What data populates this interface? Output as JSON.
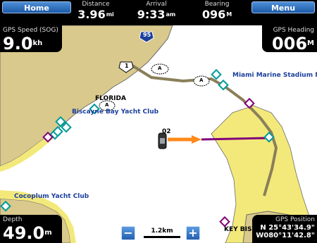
{
  "topbar": {
    "home_label": "Home",
    "menu_label": "Menu",
    "distance": {
      "label": "Distance",
      "value": "3.96",
      "unit": "mi"
    },
    "arrival": {
      "label": "Arrival",
      "value": "9:33",
      "unit": "am"
    },
    "bearing": {
      "label": "Bearing",
      "value": "096",
      "unit": "M"
    }
  },
  "gps_speed": {
    "label": "GPS Speed (SOG)",
    "value": "9.0",
    "unit": "kh"
  },
  "gps_heading": {
    "label": "GPS Heading",
    "value": "006",
    "unit": "M"
  },
  "depth": {
    "label": "Depth",
    "value": "49.0",
    "unit": "m"
  },
  "gps_position": {
    "label": "GPS Position",
    "lat": "N  25°43'34.9\"",
    "lon": "W080°11'42.8\""
  },
  "scale": {
    "value": "1.2km",
    "zoom_out": "−",
    "zoom_in": "+"
  },
  "map": {
    "labels": {
      "florida": "FLORIDA",
      "biscayne": "Biscayne Bay Yacht Club",
      "miami_marine": "Miami Marine Stadium Mar",
      "cocoplum": "Cocoplum Yacht Club",
      "key_bis": "KEY BIS",
      "highway_95": "95",
      "highway_1": "1",
      "mark_a1": "A",
      "mark_a2": "A",
      "mark_a3": "A",
      "depth_02": "02"
    },
    "colors": {
      "land": "#d9c98c",
      "shallow": "#f3e97a",
      "water": "#ffffff",
      "route": "#80007a",
      "heading": "#ff8a1a",
      "track": "#8a7f5a"
    }
  }
}
